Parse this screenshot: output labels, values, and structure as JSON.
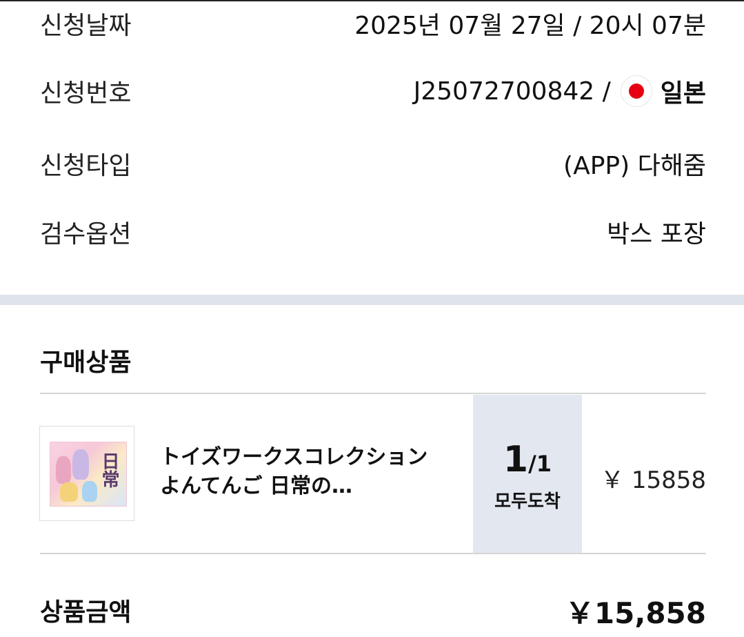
{
  "info": {
    "date": {
      "label": "신청날짜",
      "value": "2025년 07월 27일 / 20시 07분"
    },
    "number": {
      "label": "신청번호",
      "value": "J25072700842 /",
      "country": "일본"
    },
    "type": {
      "label": "신청타입",
      "value": "(APP) 다해줌"
    },
    "option": {
      "label": "검수옵션",
      "value": "박스 포장"
    }
  },
  "purchase": {
    "title": "구매상품",
    "item": {
      "name": "トイズワークスコレクション よんてんご 日常の…",
      "qty_received": "1",
      "qty_total": "/1",
      "status": "모두도착",
      "price": "￥ 15858"
    }
  },
  "total": {
    "label": "상품금액",
    "value": "￥15,858"
  },
  "colors": {
    "accent_flag": "#e60012",
    "band": "#dfe4ec",
    "qty_bg": "#e3e8f0"
  },
  "icons": {
    "country_flag": "japan-flag-icon",
    "thumbnail": "product-thumbnail"
  }
}
